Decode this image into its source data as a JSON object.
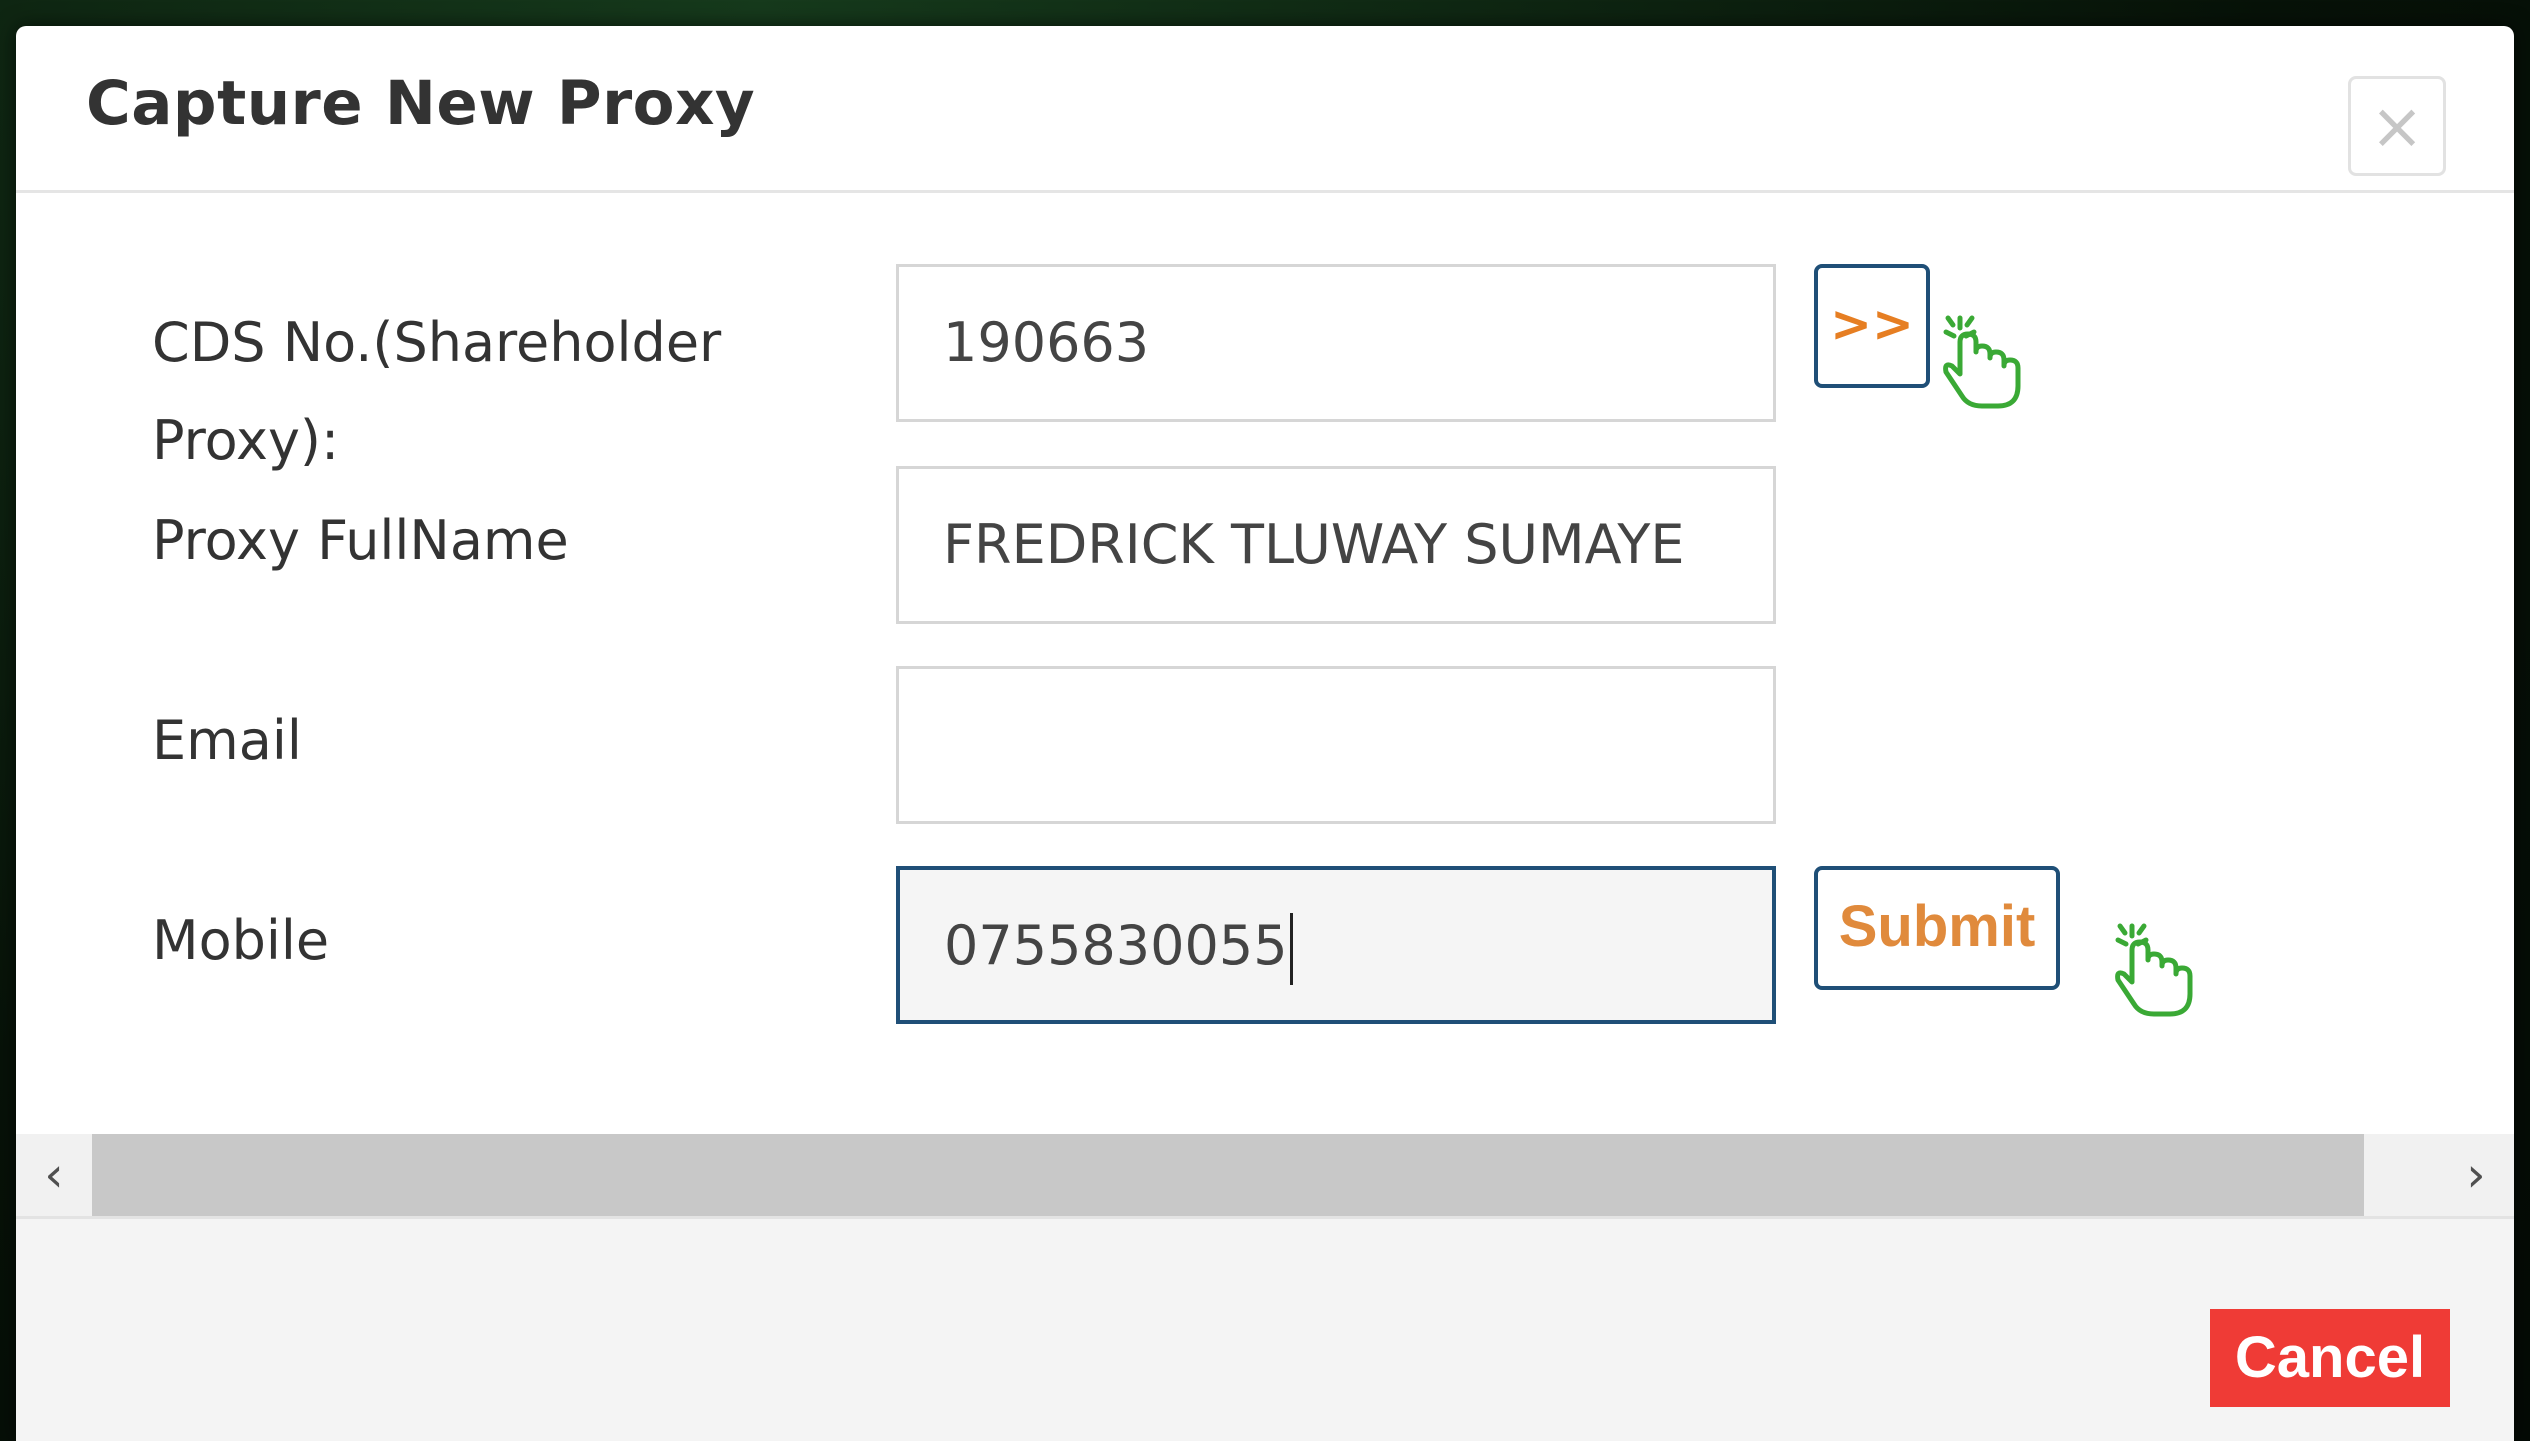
{
  "modal": {
    "title": "Capture New Proxy",
    "close_symbol": "×"
  },
  "form": {
    "cds_label_line1": "CDS No.(Shareholder",
    "cds_label_line2": "Proxy):",
    "cds_value": "190663",
    "lookup_button_label": ">>",
    "fullname_label": "Proxy FullName",
    "fullname_value": "FREDRICK TLUWAY SUMAYE",
    "email_label": "Email",
    "email_value": "",
    "mobile_label": "Mobile",
    "mobile_value": "0755830055",
    "submit_label": "Submit"
  },
  "scrollbar": {
    "left_arrow": "‹",
    "right_arrow": "›"
  },
  "footer": {
    "cancel_label": "Cancel"
  },
  "colors": {
    "accent_orange": "#e67e22",
    "button_border": "#1f4f77",
    "cancel_red": "#ef3b36",
    "pointer_green": "#3aa935"
  },
  "icons": [
    "close-icon",
    "pointer-hand-icon",
    "chevron-left-icon",
    "chevron-right-icon"
  ]
}
